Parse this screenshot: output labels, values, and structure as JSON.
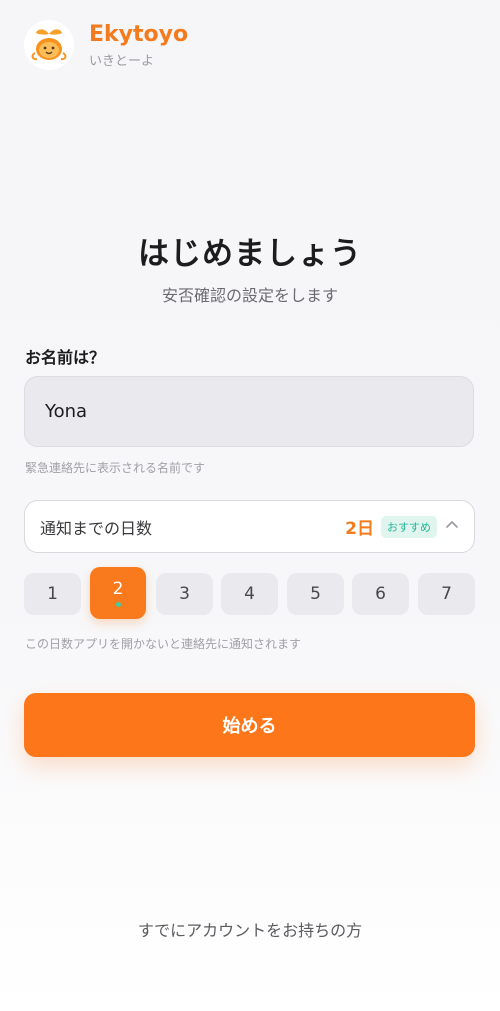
{
  "brand": {
    "name": "Ekytoyo",
    "subtitle": "いきとーよ"
  },
  "heading": {
    "title": "はじめましょう",
    "subtitle": "安否確認の設定をします"
  },
  "name_section": {
    "label": "お名前は？",
    "value": "Yona",
    "hint": "緊急連絡先に表示される名前です"
  },
  "days_section": {
    "label": "通知までの日数",
    "value": "2日",
    "badge": "おすすめ",
    "options": [
      "1",
      "2",
      "3",
      "4",
      "5",
      "6",
      "7"
    ],
    "selected": "2",
    "hint": "この日数アプリを開かないと連絡先に通知されます"
  },
  "actions": {
    "start": "始める",
    "login": "すでにアカウントをお持ちの方"
  },
  "colors": {
    "accent": "#f97a1c",
    "badge_text": "#27b59a",
    "dot": "#3ecf9d"
  },
  "icons": {
    "logo": "orange-mascot-icon",
    "expand": "chevron-up-icon"
  }
}
